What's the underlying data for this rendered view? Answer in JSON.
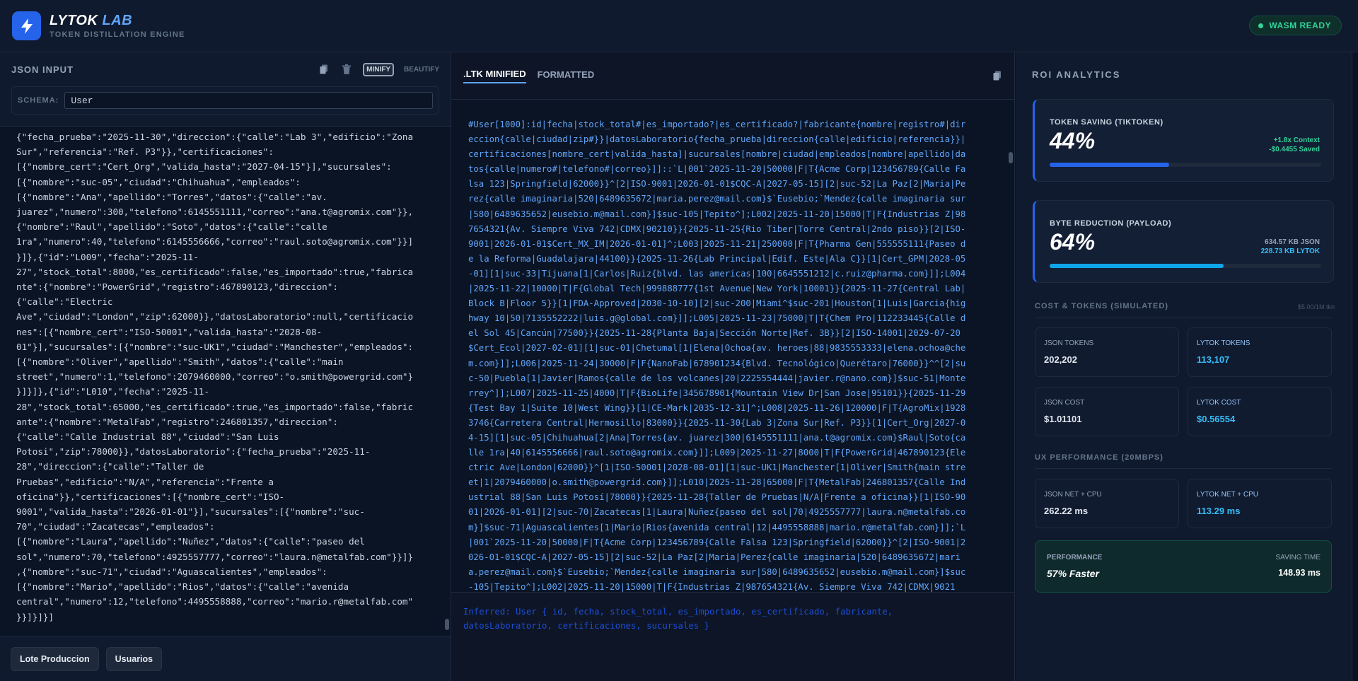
{
  "header": {
    "brand_main": "LYTOK",
    "brand_accent": "LAB",
    "subtitle": "TOKEN DISTILLATION ENGINE",
    "status": "WASM READY",
    "logo_icon": "lightning-bolt-icon"
  },
  "left": {
    "title": "JSON INPUT",
    "copy_icon": "copy-icon",
    "trash_icon": "trash-icon",
    "minify_label": "MINIFY",
    "beautify_label": "BEAUTIFY",
    "schema_label": "SCHEMA:",
    "schema_value": "User",
    "json_text": "{\"fecha_prueba\":\"2025-11-30\",\"direccion\":{\"calle\":\"Lab 3\",\"edificio\":\"Zona\nSur\",\"referencia\":\"Ref. P3\"}},\"certificaciones\":\n[{\"nombre_cert\":\"Cert_Org\",\"valida_hasta\":\"2027-04-15\"}],\"sucursales\":\n[{\"nombre\":\"suc-05\",\"ciudad\":\"Chihuahua\",\"empleados\":\n[{\"nombre\":\"Ana\",\"apellido\":\"Torres\",\"datos\":{\"calle\":\"av.\njuarez\",\"numero\":300,\"telefono\":6145551111,\"correo\":\"ana.t@agromix.com\"}},\n{\"nombre\":\"Raul\",\"apellido\":\"Soto\",\"datos\":{\"calle\":\"calle\n1ra\",\"numero\":40,\"telefono\":6145556666,\"correo\":\"raul.soto@agromix.com\"}}]\n}]},{\"id\":\"L009\",\"fecha\":\"2025-11-\n27\",\"stock_total\":8000,\"es_certificado\":false,\"es_importado\":true,\"fabrica\nnte\":{\"nombre\":\"PowerGrid\",\"registro\":467890123,\"direccion\":\n{\"calle\":\"Electric\nAve\",\"ciudad\":\"London\",\"zip\":62000}},\"datosLaboratorio\":null,\"certificacio\nnes\":[{\"nombre_cert\":\"ISO-50001\",\"valida_hasta\":\"2028-08-\n01\"}],\"sucursales\":[{\"nombre\":\"suc-UK1\",\"ciudad\":\"Manchester\",\"empleados\":\n[{\"nombre\":\"Oliver\",\"apellido\":\"Smith\",\"datos\":{\"calle\":\"main\nstreet\",\"numero\":1,\"telefono\":2079460000,\"correo\":\"o.smith@powergrid.com\"}\n}]}]},{\"id\":\"L010\",\"fecha\":\"2025-11-\n28\",\"stock_total\":65000,\"es_certificado\":true,\"es_importado\":false,\"fabric\nante\":{\"nombre\":\"MetalFab\",\"registro\":246801357,\"direccion\":\n{\"calle\":\"Calle Industrial 88\",\"ciudad\":\"San Luis\nPotosi\",\"zip\":78000}},\"datosLaboratorio\":{\"fecha_prueba\":\"2025-11-\n28\",\"direccion\":{\"calle\":\"Taller de\nPruebas\",\"edificio\":\"N/A\",\"referencia\":\"Frente a\noficina\"}},\"certificaciones\":[{\"nombre_cert\":\"ISO-\n9001\",\"valida_hasta\":\"2026-01-01\"}],\"sucursales\":[{\"nombre\":\"suc-\n70\",\"ciudad\":\"Zacatecas\",\"empleados\":\n[{\"nombre\":\"Laura\",\"apellido\":\"Nuñez\",\"datos\":{\"calle\":\"paseo del\nsol\",\"numero\":70,\"telefono\":4925557777,\"correo\":\"laura.n@metalfab.com\"}}]}\n,{\"nombre\":\"suc-71\",\"ciudad\":\"Aguascalientes\",\"empleados\":\n[{\"nombre\":\"Mario\",\"apellido\":\"Rios\",\"datos\":{\"calle\":\"avenida\ncentral\",\"numero\":12,\"telefono\":4495558888,\"correo\":\"mario.r@metalfab.com\"\n}}]}]}]",
    "footer_buttons": [
      "Lote Produccion",
      "Usuarios"
    ]
  },
  "middle": {
    "tabs": [
      ".LTK MINIFIED",
      "FORMATTED"
    ],
    "copy_icon": "copy-icon",
    "ltk_text": "#User[1000]:id|fecha|stock_total#|es_importado?|es_certificado?|fabricante{nombre|registro#|dir\neccion{calle|ciudad|zip#}}|datosLaboratorio{fecha_prueba|direccion{calle|edificio|referencia}}|\ncertificaciones[nombre_cert|valida_hasta]|sucursales[nombre|ciudad|empleados[nombre|apellido|da\ntos{calle|numero#|telefono#|correo}]]::`L|001`2025-11-20|50000|F|T{Acme Corp|123456789{Calle Fa\nlsa 123|Springfield|62000}}^[2|ISO-9001|2026-01-01$CQC-A|2027-05-15][2|suc-52|La Paz[2|Maria|Pe\nrez{calle imaginaria|520|6489635672|maria.perez@mail.com}$`Eusebio;`Mendez{calle imaginaria sur\n|580|6489635652|eusebio.m@mail.com}]$suc-105|Tepito^];L002|2025-11-20|15000|T|F{Industrias Z|98\n7654321{Av. Siempre Viva 742|CDMX|90210}}{2025-11-25{Rio Tiber|Torre Central|2ndo piso}}[2|ISO-\n9001|2026-01-01$Cert_MX_IM|2026-01-01]^;L003|2025-11-21|250000|F|T{Pharma Gen|555555111{Paseo d\ne la Reforma|Guadalajara|44100}}{2025-11-26{Lab Principal|Edif. Este|Ala C}}[1|Cert_GPM|2028-05\n-01][1|suc-33|Tijuana[1|Carlos|Ruiz{blvd. las americas|100|6645551212|c.ruiz@pharma.com}]];L004\n|2025-11-22|10000|T|F{Global Tech|999888777{1st Avenue|New York|10001}}{2025-11-27{Central Lab|\nBlock B|Floor 5}}[1|FDA-Approved|2030-10-10][2|suc-200|Miami^$suc-201|Houston[1|Luis|Garcia{hig\nhway 10|50|7135552222|luis.g@global.com}]];L005|2025-11-23|75000|T|T{Chem Pro|112233445{Calle d\nel Sol 45|Cancún|77500}}{2025-11-28{Planta Baja|Sección Norte|Ref. 3B}}[2|ISO-14001|2029-07-20\n$Cert_Ecol|2027-02-01][1|suc-01|Chetumal[1|Elena|Ochoa{av. heroes|88|9835553333|elena.ochoa@che\nm.com}]];L006|2025-11-24|30000|F|F{NanoFab|678901234{Blvd. Tecnológico|Querétaro|76000}}^^[2|su\nc-50|Puebla[1|Javier|Ramos{calle de los volcanes|20|2225554444|javier.r@nano.com}]$suc-51|Monte\nrrey^]];L007|2025-11-25|4000|T|F{BioLife|345678901{Mountain View Dr|San Jose|95101}}{2025-11-29\n{Test Bay 1|Suite 10|West Wing}}[1|CE-Mark|2035-12-31]^;L008|2025-11-26|120000|F|T{AgroMix|1928\n3746{Carretera Central|Hermosillo|83000}}{2025-11-30{Lab 3|Zona Sur|Ref. P3}}[1|Cert_Org|2027-0\n4-15][1|suc-05|Chihuahua[2|Ana|Torres{av. juarez|300|6145551111|ana.t@agromix.com}$Raul|Soto{ca\nlle 1ra|40|6145556666|raul.soto@agromix.com}]];L009|2025-11-27|8000|T|F{PowerGrid|467890123{Ele\nctric Ave|London|62000}}^[1|ISO-50001|2028-08-01][1|suc-UK1|Manchester[1|Oliver|Smith{main stre\net|1|2079460000|o.smith@powergrid.com}]];L010|2025-11-28|65000|F|T{MetalFab|246801357{Calle Ind\nustrial 88|San Luis Potosí|78000}}{2025-11-28{Taller de Pruebas|N/A|Frente a oficina}}[1|ISO-90\n01|2026-01-01][2|suc-70|Zacatecas[1|Laura|Nuñez{paseo del sol|70|4925557777|laura.n@metalfab.co\nm}]$suc-71|Aguascalientes[1|Mario|Rios{avenida central|12|4495558888|mario.r@metalfab.com}]];`L\n|001`2025-11-20|50000|F|T{Acme Corp|123456789{Calle Falsa 123|Springfield|62000}}^[2|ISO-9001|2\n026-01-01$CQC-A|2027-05-15][2|suc-52|La Paz[2|Maria|Perez{calle imaginaria|520|6489635672|mari\na.perez@mail.com}$`Eusebio;`Mendez{calle imaginaria sur|580|6489635652|eusebio.m@mail.com}]$suc\n-105|Tepito^];L002|2025-11-20|15000|T|F{Industrias Z|987654321{Av. Siempre Viva 742|CDMX|9021",
    "inferred_text": "Inferred: User { id, fecha, stock_total, es_importado, es_certificado, fabricante,\ndatosLaboratorio, certificaciones, sucursales }"
  },
  "right": {
    "title": "ROI ANALYTICS",
    "token_card": {
      "label": "TOKEN SAVING (TIKTOKEN)",
      "value": "44%",
      "fraction": 0.44,
      "note1": "+1.8x Context",
      "note2": "-$0.4455 Saved",
      "color": "#2563eb"
    },
    "byte_card": {
      "label": "BYTE REDUCTION (PAYLOAD)",
      "value": "64%",
      "fraction": 0.64,
      "note1": "634.57 KB JSON",
      "note2": "228.73 KB LYTOK",
      "color": "#0ea5e9"
    },
    "cost_section": {
      "title": "COST & TOKENS (SIMULATED)",
      "note": "$5.00/1M tkn"
    },
    "json_tokens": {
      "label": "JSON TOKENS",
      "value": "202,202"
    },
    "lytok_tokens": {
      "label": "LYTOK TOKENS",
      "value": "113,107"
    },
    "json_cost": {
      "label": "JSON COST",
      "value": "$1.01101"
    },
    "lytok_cost": {
      "label": "LYTOK COST",
      "value": "$0.56554"
    },
    "ux_section": {
      "title": "UX PERFORMANCE (20MBPS)"
    },
    "json_net": {
      "label": "JSON NET + CPU",
      "value": "262.22 ms"
    },
    "lytok_net": {
      "label": "LYTOK NET + CPU",
      "value": "113.29 ms"
    },
    "performance": {
      "label": "PERFORMANCE",
      "value": "57% Faster",
      "rlabel": "SAVING TIME",
      "rvalue": "148.93 ms"
    }
  }
}
